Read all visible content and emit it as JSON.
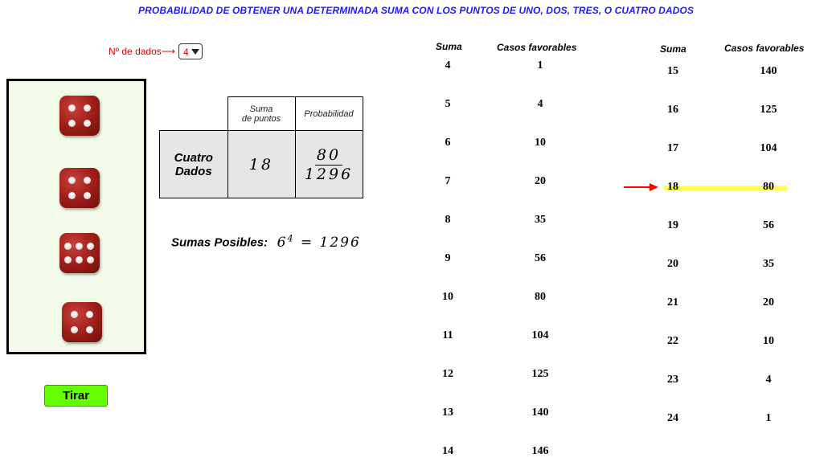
{
  "title": "PROBABILIDAD DE OBTENER UNA DETERMINADA SUMA CON LOS PUNTOS DE UNO, DOS, TRES, O CUATRO DADOS",
  "dice_selector": {
    "label": "Nº de dados⟶",
    "value": "4"
  },
  "dice": [
    {
      "face": 4,
      "icon": "die-four-icon"
    },
    {
      "face": 4,
      "icon": "die-four-icon"
    },
    {
      "face": 6,
      "icon": "die-six-icon"
    },
    {
      "face": 4,
      "icon": "die-four-icon"
    }
  ],
  "roll_button": "Tirar",
  "prob_table": {
    "header_suma_line1": "Suma",
    "header_suma_line2": "de puntos",
    "header_prob": "Probabilidad",
    "row_label_line1": "Cuatro",
    "row_label_line2": "Dados",
    "sum": "18",
    "numerator": "80",
    "denominator": "1296"
  },
  "posibles": {
    "label": "Sumas Posibles:",
    "base": "6",
    "exp": "4",
    "eq": "=",
    "result": "1296"
  },
  "col_headers": {
    "suma": "Suma",
    "casos": "Casos favorables"
  },
  "table_left": [
    {
      "suma": "4",
      "casos": "1"
    },
    {
      "suma": "5",
      "casos": "4"
    },
    {
      "suma": "6",
      "casos": "10"
    },
    {
      "suma": "7",
      "casos": "20"
    },
    {
      "suma": "8",
      "casos": "35"
    },
    {
      "suma": "9",
      "casos": "56"
    },
    {
      "suma": "10",
      "casos": "80"
    },
    {
      "suma": "11",
      "casos": "104"
    },
    {
      "suma": "12",
      "casos": "125"
    },
    {
      "suma": "13",
      "casos": "140"
    },
    {
      "suma": "14",
      "casos": "146"
    }
  ],
  "table_right": [
    {
      "suma": "15",
      "casos": "140"
    },
    {
      "suma": "16",
      "casos": "125"
    },
    {
      "suma": "17",
      "casos": "104"
    },
    {
      "suma": "18",
      "casos": "80"
    },
    {
      "suma": "19",
      "casos": "56"
    },
    {
      "suma": "20",
      "casos": "35"
    },
    {
      "suma": "21",
      "casos": "20"
    },
    {
      "suma": "22",
      "casos": "10"
    },
    {
      "suma": "23",
      "casos": "4"
    },
    {
      "suma": "24",
      "casos": "1"
    }
  ],
  "highlighted_sum": "18",
  "colors": {
    "title": "#1a1aff",
    "label_red": "#e00000",
    "button": "#66ff00",
    "highlight": "#ffff55",
    "arrow": "#ff0000",
    "dice_bg": "#f1fbe8"
  }
}
